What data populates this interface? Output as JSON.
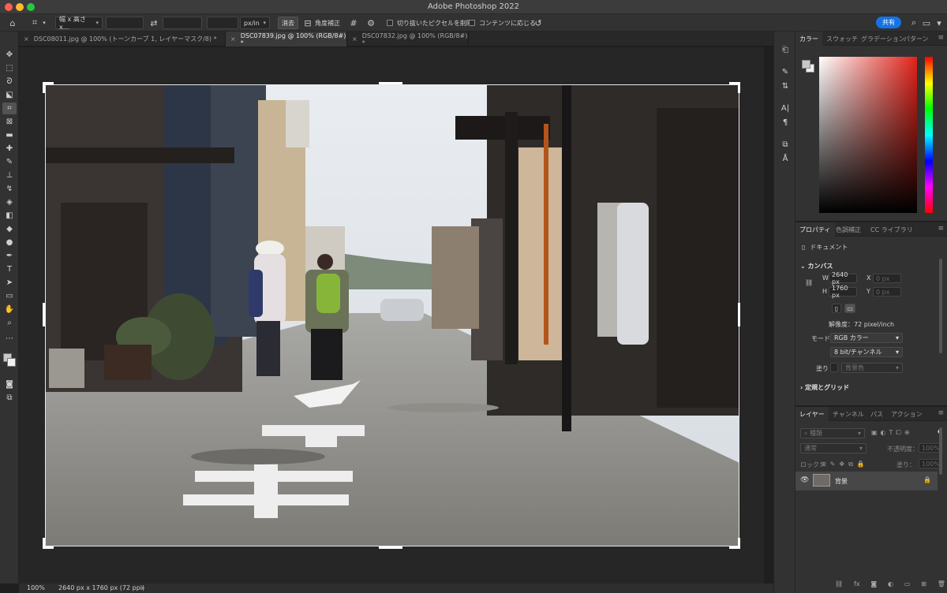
{
  "app": {
    "title": "Adobe Photoshop 2022"
  },
  "options_bar": {
    "ratio_select": "幅 x 高さ x...",
    "unit_select": "px/in",
    "clear_button": "消去",
    "straighten_label": "角度補正",
    "delete_cropped_label": "切り抜いたピクセルを削除",
    "content_aware_label": "コンテンツに応じる",
    "share_button": "共有"
  },
  "tabs": [
    {
      "label": "DSC08011.jpg @ 100% (トーンカーブ 1, レイヤーマスク/8) *",
      "active": false
    },
    {
      "label": "DSC07839.jpg @ 100% (RGB/8#) *",
      "active": true
    },
    {
      "label": "DSC07832.jpg @ 100% (RGB/8#) *",
      "active": false
    }
  ],
  "status_bar": {
    "zoom": "100%",
    "doc_info": "2640 px x 1760 px (72 ppi)",
    "arrow": "›"
  },
  "color_panel": {
    "tabs": [
      "カラー",
      "スウォッチ",
      "グラデーション",
      "パターン"
    ],
    "foreground": "#c8c8c8",
    "background": "#eeeeee"
  },
  "properties_panel": {
    "tabs": [
      "プロパティ",
      "色調補正",
      "CC ライブラリ"
    ],
    "doc_label": "ドキュメント",
    "canvas_section": "カンバス",
    "w_label": "W",
    "w_value": "2640 px",
    "h_label": "H",
    "h_value": "1760 px",
    "x_label": "X",
    "x_placeholder": "0 px",
    "y_label": "Y",
    "y_placeholder": "0 px",
    "resolution": "解像度：72 pixel/inch",
    "mode_label": "モード",
    "mode_value": "RGB カラー",
    "depth_value": "8 bit/チャンネル",
    "fill_label": "塗り",
    "fill_value": "背景色",
    "rulers_section": "定規とグリッド"
  },
  "layers_panel": {
    "tabs": [
      "レイヤー",
      "チャンネル",
      "パス",
      "アクション"
    ],
    "kind_placeholder": "種類",
    "blend_mode": "通常",
    "opacity_label": "不透明度：",
    "opacity_value": "100%",
    "lock_label": "ロック：",
    "fill_label": "塗り：",
    "fill_value": "100%",
    "layer_name": "背景",
    "footer_icons": [
      "link-icon",
      "fx-icon",
      "mask-icon",
      "adjustment-icon",
      "group-icon",
      "new-layer-icon",
      "trash-icon"
    ]
  }
}
